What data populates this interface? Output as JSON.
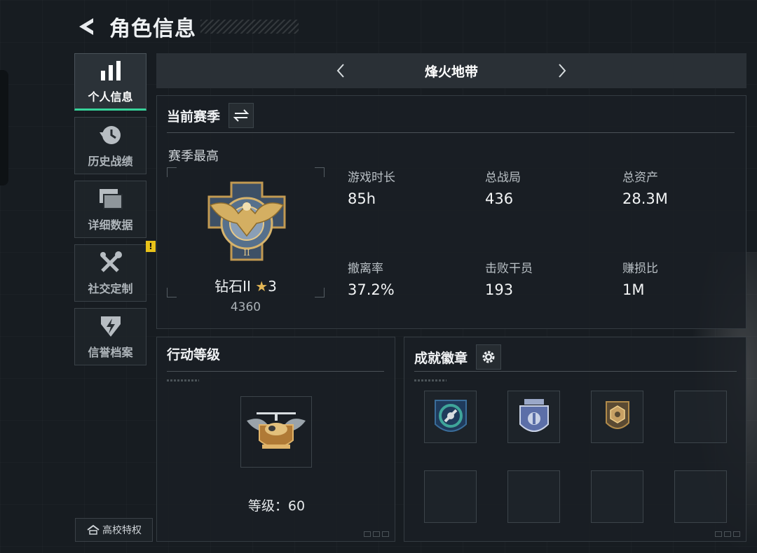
{
  "header": {
    "title": "角色信息",
    "back_icon": "back-arrow-icon"
  },
  "sidebar": {
    "items": [
      {
        "label": "个人信息",
        "icon": "bar-chart-icon",
        "active": true
      },
      {
        "label": "历史战绩",
        "icon": "history-clock-icon",
        "active": false
      },
      {
        "label": "详细数据",
        "icon": "stacked-windows-icon",
        "active": false
      },
      {
        "label": "社交定制",
        "icon": "tools-icon",
        "active": false,
        "badge": "!"
      },
      {
        "label": "信誉档案",
        "icon": "shield-bolt-icon",
        "active": false
      }
    ],
    "campus_button": "高校特权"
  },
  "map_selector": {
    "name": "烽火地带"
  },
  "season": {
    "title": "当前赛季",
    "subtitle": "赛季最高",
    "rank": {
      "name": "钻石II",
      "star_glyph": "★",
      "stars": "3",
      "score": "4360"
    },
    "stats": [
      {
        "label": "游戏时长",
        "value": "85h"
      },
      {
        "label": "总战局",
        "value": "436"
      },
      {
        "label": "总资产",
        "value": "28.3M"
      },
      {
        "label": "撤离率",
        "value": "37.2%"
      },
      {
        "label": "击败干员",
        "value": "193"
      },
      {
        "label": "赚损比",
        "value": "1M"
      }
    ]
  },
  "level": {
    "title": "行动等级",
    "level_text": "等级：60"
  },
  "achievements": {
    "title": "成就徽章",
    "slots": [
      "blue-circle-badge-icon",
      "blue-shield-badge-icon",
      "gold-hexagon-badge-icon",
      "",
      "",
      "",
      "",
      ""
    ]
  },
  "colors": {
    "accent": "#37d39a",
    "background": "#171c21",
    "gold": "#e2b655",
    "badge": "#e8c21a"
  }
}
